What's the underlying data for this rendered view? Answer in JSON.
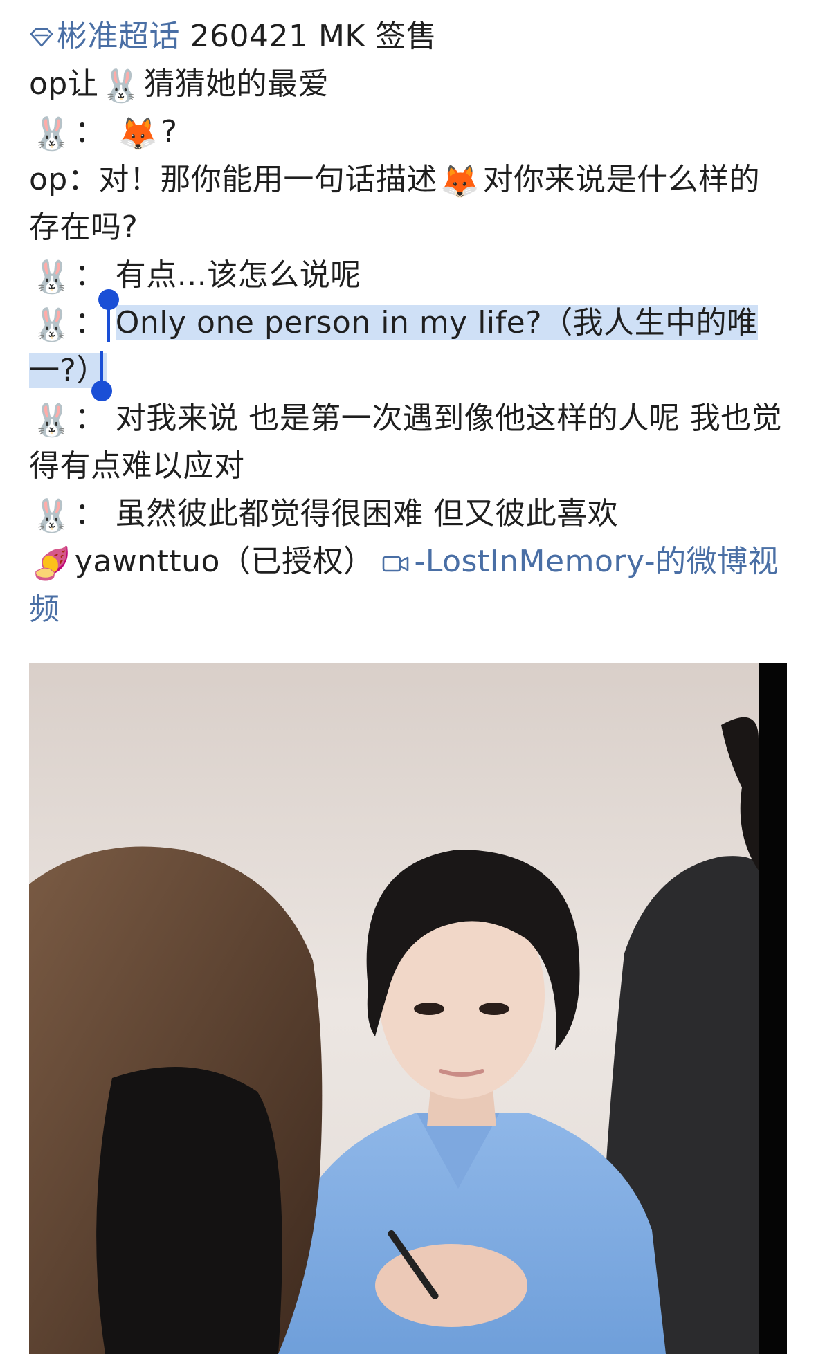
{
  "post": {
    "topic_link": "彬准超话",
    "title_rest": " 260421 MK 签售",
    "line2_prefix": "op让",
    "line2_suffix": "猜猜她的最爱",
    "line3_sep": "：",
    "line3_suffix": "?",
    "line4": "op：对！那你能用一句话描述",
    "line4_suffix": "对你来说是什么样的存在吗?",
    "line5_sep": "：",
    "line5_text": "有点...该怎么说呢",
    "line6_sep": "：",
    "line6_selected": "Only one person in my life?（我人生中的唯一?）",
    "line7_sep": "：",
    "line7_text": "对我来说 也是第一次遇到像他这样的人呢 我也觉得有点难以应对",
    "line8_sep": "：",
    "line8_text": "虽然彼此都觉得很困难 但又彼此喜欢",
    "credit_user": "yawnttuo（已授权）",
    "video_link": "-LostInMemory-的微博视频"
  },
  "emojis": {
    "rabbit": "🐰",
    "fox": "🦊",
    "sweet_potato": "🍠"
  },
  "icons": {
    "topic": "diamond-icon",
    "video": "video-camera-icon"
  },
  "colors": {
    "link": "#4a6fa5",
    "selection_bg": "#cfe0f6",
    "selection_handle": "#1a4fd6"
  }
}
